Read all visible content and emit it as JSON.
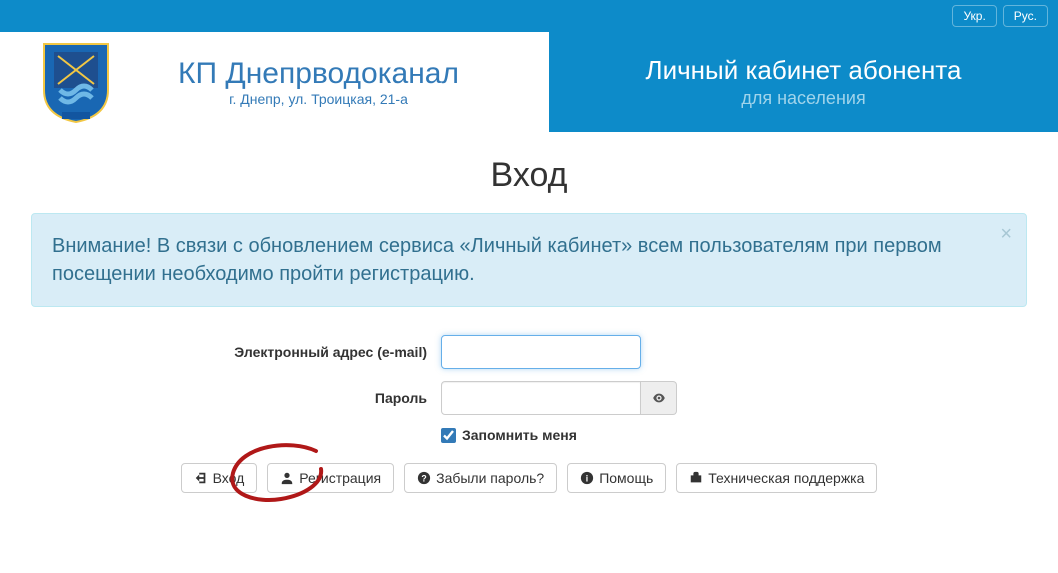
{
  "topbar": {
    "lang_uk": "Укр.",
    "lang_ru": "Рус."
  },
  "header": {
    "brand_title": "КП Днепрводоканал",
    "brand_sub": "г. Днепр, ул. Троицкая, 21-а",
    "cabinet_title": "Личный кабинет абонента",
    "cabinet_sub": "для населения"
  },
  "page": {
    "title": "Вход"
  },
  "alert": {
    "text": "Внимание! В связи с обновлением сервиса «Личный кабинет» всем пользователям при первом посещении необходимо пройти регистрацию.",
    "close": "×"
  },
  "form": {
    "email_label": "Электронный адрес (e-mail)",
    "email_value": "",
    "password_label": "Пароль",
    "password_value": "",
    "remember_label": "Запомнить меня",
    "remember_checked": true
  },
  "buttons": {
    "login": "Вход",
    "register": "Регистрация",
    "forgot": "Забыли пароль?",
    "help": "Помощь",
    "support": "Техническая поддержка"
  }
}
